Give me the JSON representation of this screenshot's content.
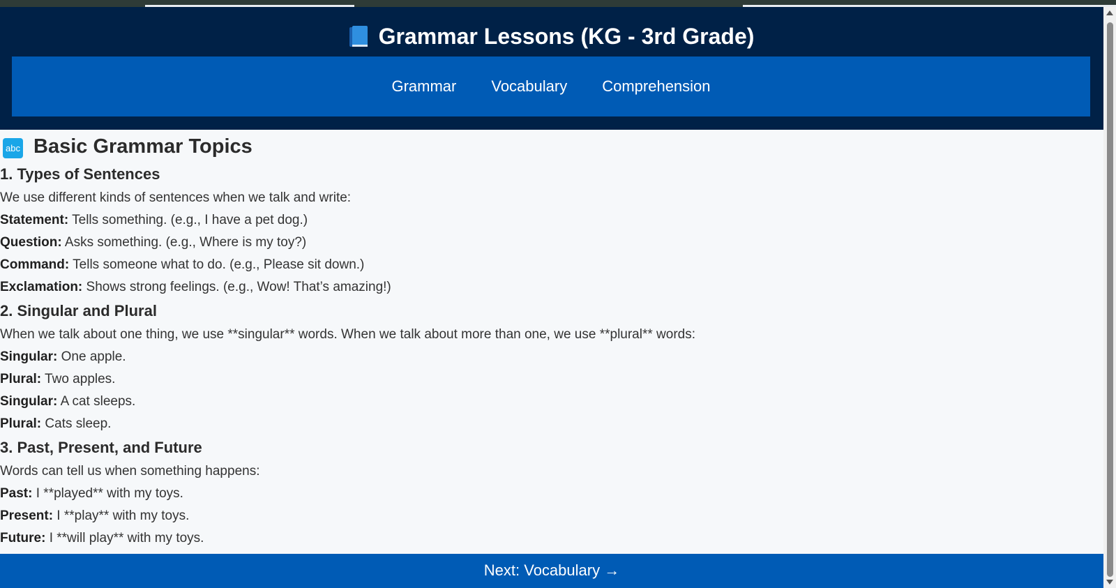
{
  "header": {
    "icon": "blue-book-icon",
    "title": "Grammar Lessons (KG - 3rd Grade)"
  },
  "nav": {
    "items": [
      {
        "label": "Grammar"
      },
      {
        "label": "Vocabulary"
      },
      {
        "label": "Comprehension"
      }
    ]
  },
  "main": {
    "heading_icon": "abc",
    "heading": "Basic Grammar Topics",
    "sections": [
      {
        "title": "1. Types of Sentences",
        "intro": "We use different kinds of sentences when we talk and write:",
        "items": [
          {
            "term": "Statement:",
            "text": " Tells something. (e.g., I have a pet dog.)"
          },
          {
            "term": "Question:",
            "text": " Asks something. (e.g., Where is my toy?)"
          },
          {
            "term": "Command:",
            "text": " Tells someone what to do. (e.g., Please sit down.)"
          },
          {
            "term": "Exclamation:",
            "text": " Shows strong feelings. (e.g., Wow! That’s amazing!)"
          }
        ]
      },
      {
        "title": "2. Singular and Plural",
        "intro": "When we talk about one thing, we use **singular** words. When we talk about more than one, we use **plural** words:",
        "items": [
          {
            "term": "Singular:",
            "text": " One apple."
          },
          {
            "term": "Plural:",
            "text": " Two apples."
          },
          {
            "term": "Singular:",
            "text": " A cat sleeps."
          },
          {
            "term": "Plural:",
            "text": " Cats sleep."
          }
        ]
      },
      {
        "title": "3. Past, Present, and Future",
        "intro": "Words can tell us when something happens:",
        "items": [
          {
            "term": "Past:",
            "text": " I **played** with my toys."
          },
          {
            "term": "Present:",
            "text": " I **play** with my toys."
          },
          {
            "term": "Future:",
            "text": " I **will play** with my toys."
          }
        ]
      }
    ]
  },
  "footer": {
    "next_label": "Next: Vocabulary →"
  },
  "colors": {
    "header_bg": "#002147",
    "nav_bg": "#005bb5",
    "page_bg": "#f6f8fa",
    "text": "#333333"
  }
}
